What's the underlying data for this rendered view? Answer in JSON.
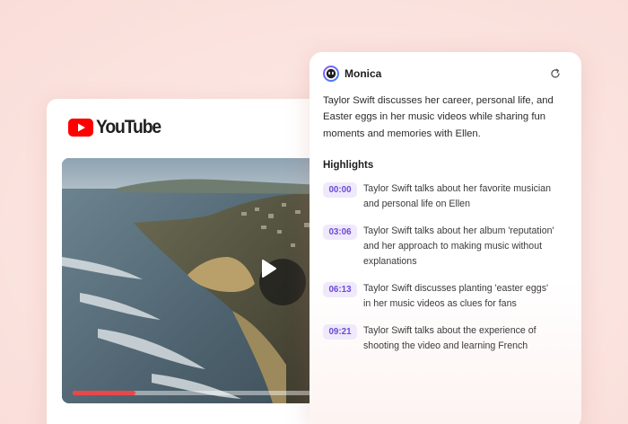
{
  "youtube": {
    "logo_text": "YouTube",
    "brand_color": "#ff0000",
    "progress_fraction": 0.26,
    "progress_color": "#e8484a"
  },
  "monica": {
    "name": "Monica",
    "summary": "Taylor Swift discusses her career, personal life, and Easter eggs in her music videos while sharing fun moments and memories with Ellen.",
    "highlights_title": "Highlights",
    "accent_color": "#6a4bd6",
    "highlights": [
      {
        "time": "00:00",
        "text": "Taylor Swift talks about her favorite musician and personal life on Ellen"
      },
      {
        "time": "03:06",
        "text": "Taylor Swift talks about her album 'reputation' and her approach to making music without explanations"
      },
      {
        "time": "06:13",
        "text": "Taylor Swift discusses planting 'easter eggs' in her music videos as clues for fans"
      },
      {
        "time": "09:21",
        "text": "Taylor Swift talks about the experience of shooting the video and learning French"
      }
    ]
  },
  "icons": [
    "youtube-logo-icon",
    "play-icon",
    "monica-logo-icon",
    "refresh-icon"
  ]
}
